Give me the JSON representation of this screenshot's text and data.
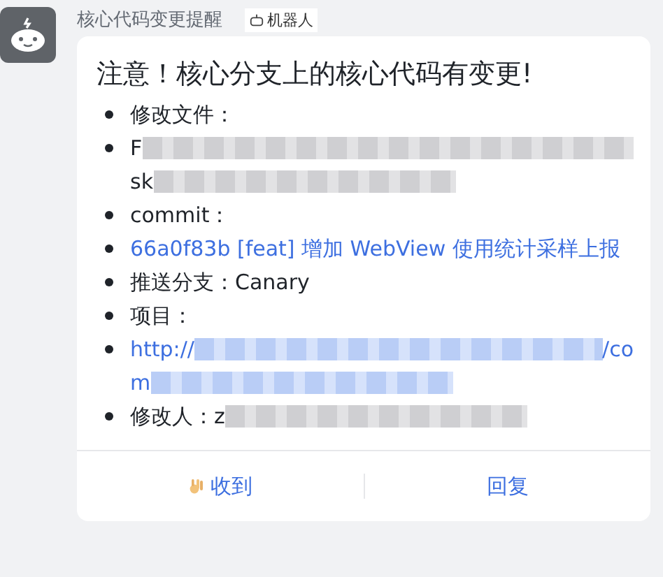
{
  "sender": {
    "name": "核心代码变更提醒",
    "tag": "机器人"
  },
  "card": {
    "title": "注意！核心分支上的核心代码有变更!",
    "items": [
      {
        "kind": "text",
        "lines": [
          [
            {
              "kind": "text",
              "text": "修改文件："
            }
          ]
        ]
      },
      {
        "kind": "text",
        "lines": [
          [
            {
              "kind": "text",
              "text": "F"
            },
            {
              "kind": "blur"
            }
          ],
          [
            {
              "kind": "text",
              "text": "sk"
            },
            {
              "kind": "blur"
            }
          ]
        ]
      },
      {
        "kind": "text",
        "lines": [
          [
            {
              "kind": "text",
              "text": "commit："
            }
          ]
        ]
      },
      {
        "kind": "link",
        "lines": [
          [
            {
              "kind": "text",
              "text": "66a0f83b [feat] 增加 WebView 使用统计采样上报"
            }
          ]
        ]
      },
      {
        "kind": "text",
        "lines": [
          [
            {
              "kind": "text",
              "text": "推送分支：Canary"
            }
          ]
        ]
      },
      {
        "kind": "text",
        "lines": [
          [
            {
              "kind": "text",
              "text": "项目："
            }
          ]
        ]
      },
      {
        "kind": "link",
        "lines": [
          [
            {
              "kind": "text",
              "text": "http://"
            },
            {
              "kind": "blur"
            },
            {
              "kind": "text",
              "text": "/co"
            }
          ],
          [
            {
              "kind": "text",
              "text": "m"
            },
            {
              "kind": "blur"
            }
          ]
        ]
      },
      {
        "kind": "text",
        "lines": [
          [
            {
              "kind": "text",
              "text": "修改人："
            },
            {
              "kind": "text",
              "text": "z"
            },
            {
              "kind": "blur"
            }
          ]
        ]
      }
    ],
    "actions": [
      {
        "kind": "ok",
        "label": "收到"
      },
      {
        "kind": "plain",
        "label": "回复"
      }
    ]
  }
}
